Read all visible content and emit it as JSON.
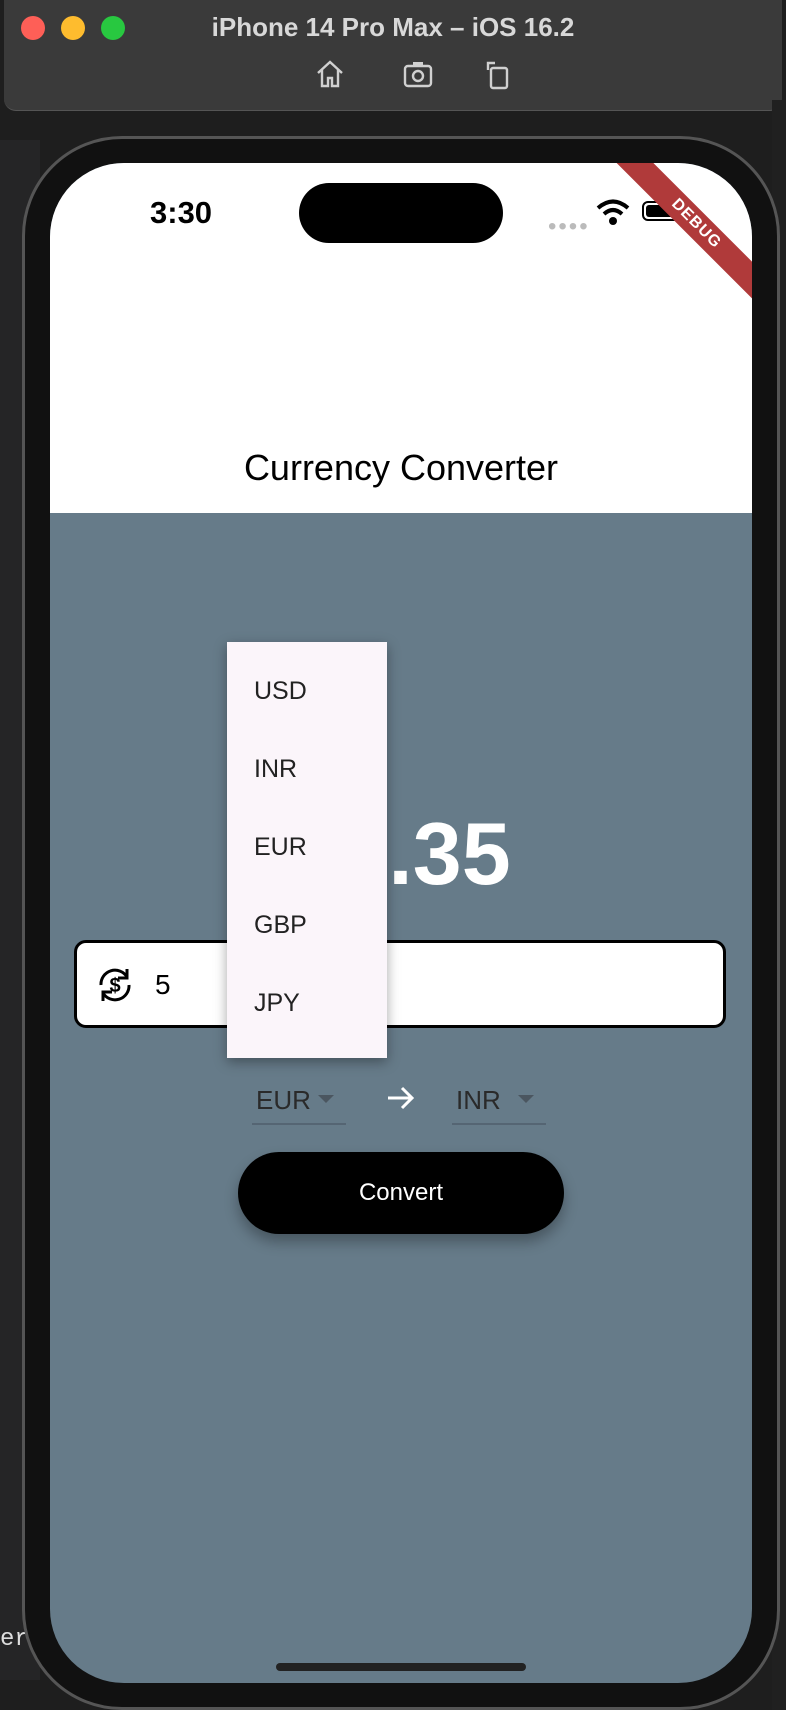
{
  "window": {
    "title": "iPhone 14 Pro Max – iOS 16.2",
    "toolbar_icons": [
      "home-icon",
      "screenshot-icon",
      "rotate-icon"
    ]
  },
  "ide": {
    "bottom_text": "er:"
  },
  "statusbar": {
    "time": "3:30"
  },
  "debug_banner": "DEBUG",
  "appbar": {
    "title": "Currency Converter"
  },
  "main": {
    "result_visible": "0.35",
    "amount_value": "5",
    "from_currency": "EUR",
    "to_currency": "INR",
    "convert_label": "Convert"
  },
  "dropdown": {
    "options": [
      "USD",
      "INR",
      "EUR",
      "GBP",
      "JPY"
    ]
  },
  "colors": {
    "screen_bg": "#667b89",
    "appbar_bg": "#ffffff",
    "button_bg": "#000000",
    "menu_bg": "#fbf5fa",
    "debug_banner": "#b03a3a"
  }
}
